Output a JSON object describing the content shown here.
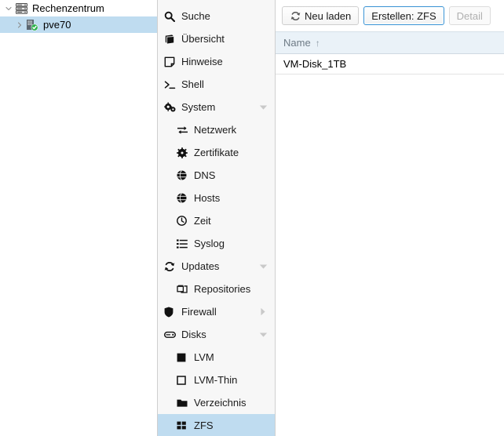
{
  "tree": {
    "items": [
      {
        "label": "Rechenzentrum",
        "icon": "datacenter-icon",
        "expanded": true,
        "selected": false,
        "level": 0
      },
      {
        "label": "pve70",
        "icon": "node-online-icon",
        "expanded": false,
        "selected": true,
        "level": 1
      }
    ]
  },
  "menu": {
    "items": [
      {
        "label": "Suche",
        "icon": "search-icon",
        "sub": false,
        "caret": "none",
        "active": false
      },
      {
        "label": "Übersicht",
        "icon": "book-icon",
        "sub": false,
        "caret": "none",
        "active": false
      },
      {
        "label": "Hinweise",
        "icon": "note-icon",
        "sub": false,
        "caret": "none",
        "active": false
      },
      {
        "label": "Shell",
        "icon": "terminal-icon",
        "sub": false,
        "caret": "none",
        "active": false
      },
      {
        "label": "System",
        "icon": "gears-icon",
        "sub": false,
        "caret": "down",
        "active": false
      },
      {
        "label": "Netzwerk",
        "icon": "network-icon",
        "sub": true,
        "caret": "none",
        "active": false
      },
      {
        "label": "Zertifikate",
        "icon": "certificate-icon",
        "sub": true,
        "caret": "none",
        "active": false
      },
      {
        "label": "DNS",
        "icon": "globe-icon",
        "sub": true,
        "caret": "none",
        "active": false
      },
      {
        "label": "Hosts",
        "icon": "globe-icon",
        "sub": true,
        "caret": "none",
        "active": false
      },
      {
        "label": "Zeit",
        "icon": "clock-icon",
        "sub": true,
        "caret": "none",
        "active": false
      },
      {
        "label": "Syslog",
        "icon": "list-icon",
        "sub": true,
        "caret": "none",
        "active": false
      },
      {
        "label": "Updates",
        "icon": "refresh-icon",
        "sub": false,
        "caret": "down",
        "active": false
      },
      {
        "label": "Repositories",
        "icon": "copy-icon",
        "sub": true,
        "caret": "none",
        "active": false
      },
      {
        "label": "Firewall",
        "icon": "shield-icon",
        "sub": false,
        "caret": "right",
        "active": false
      },
      {
        "label": "Disks",
        "icon": "disk-icon",
        "sub": false,
        "caret": "down",
        "active": false
      },
      {
        "label": "LVM",
        "icon": "square-filled-icon",
        "sub": true,
        "caret": "none",
        "active": false
      },
      {
        "label": "LVM-Thin",
        "icon": "square-outline-icon",
        "sub": true,
        "caret": "none",
        "active": false
      },
      {
        "label": "Verzeichnis",
        "icon": "folder-icon",
        "sub": true,
        "caret": "none",
        "active": false
      },
      {
        "label": "ZFS",
        "icon": "grid-squares-icon",
        "sub": true,
        "caret": "none",
        "active": true
      }
    ]
  },
  "toolbar": {
    "reload_label": "Neu laden",
    "create_label": "Erstellen: ZFS",
    "detail_label": "Detail"
  },
  "grid": {
    "columns": [
      {
        "label": "Name",
        "sort": "↑"
      }
    ],
    "rows": [
      {
        "name": "VM-Disk_1TB"
      }
    ]
  },
  "colors": {
    "selection": "#bfdcf0",
    "focus_border": "#3892d4",
    "header_bg": "#eaf2f8",
    "status_ok": "#2bb24c"
  }
}
